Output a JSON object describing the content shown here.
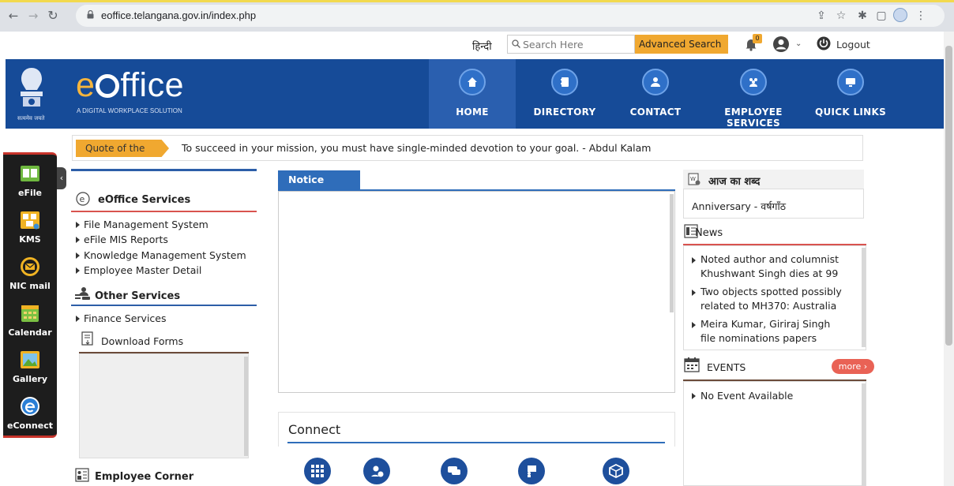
{
  "browser": {
    "url": "eoffice.telangana.gov.in/index.php"
  },
  "topbar": {
    "language": "हिन्दी",
    "search_placeholder": "Search Here",
    "advanced_search": "Advanced Search",
    "notification_count": "0",
    "logout": "Logout"
  },
  "header": {
    "logo_e": "e",
    "logo_rest": "ffice",
    "tagline": "A DIGITAL WORKPLACE SOLUTION",
    "emblem_caption": "सत्यमेव जयते",
    "nav": [
      {
        "label": "HOME"
      },
      {
        "label": "DIRECTORY"
      },
      {
        "label": "CONTACT"
      },
      {
        "label": "EMPLOYEE SERVICES"
      },
      {
        "label": "QUICK LINKS"
      }
    ]
  },
  "quote": {
    "label": "Quote of the week",
    "text": "To succeed in your mission, you must have single-minded devotion to your goal. - Abdul Kalam"
  },
  "dock": {
    "items": [
      {
        "label": "eFile"
      },
      {
        "label": "KMS"
      },
      {
        "label": "NIC mail"
      },
      {
        "label": "Calendar"
      },
      {
        "label": "Gallery"
      },
      {
        "label": "eConnect"
      }
    ]
  },
  "left_panel": {
    "eoffice_services_title": "eOffice Services",
    "eoffice_links": [
      "File Management System",
      "eFile MIS Reports",
      "Knowledge Management System",
      "Employee Master Detail"
    ],
    "other_services_title": "Other Services",
    "other_links": [
      "Finance Services"
    ],
    "download_forms": "Download Forms",
    "employee_corner": "Employee Corner"
  },
  "notice_board": {
    "title": "Notice Board"
  },
  "connect": {
    "title": "Connect"
  },
  "right_panel": {
    "word_of_day_title": "आज का शब्द",
    "word_of_day": "Anniversary - वर्षगाँठ",
    "news_title": "News",
    "news": [
      "Noted author and columnist Khushwant Singh dies at 99",
      "Two objects spotted possibly related to MH370: Australia",
      "Meira Kumar, Giriraj Singh file nominations papers"
    ],
    "events_title": "EVENTS",
    "more": "more ›",
    "events": [
      "No Event Available"
    ]
  },
  "colors": {
    "header_blue": "#164b98",
    "accent_orange": "#f0a830",
    "accent_red": "#d9534f"
  }
}
